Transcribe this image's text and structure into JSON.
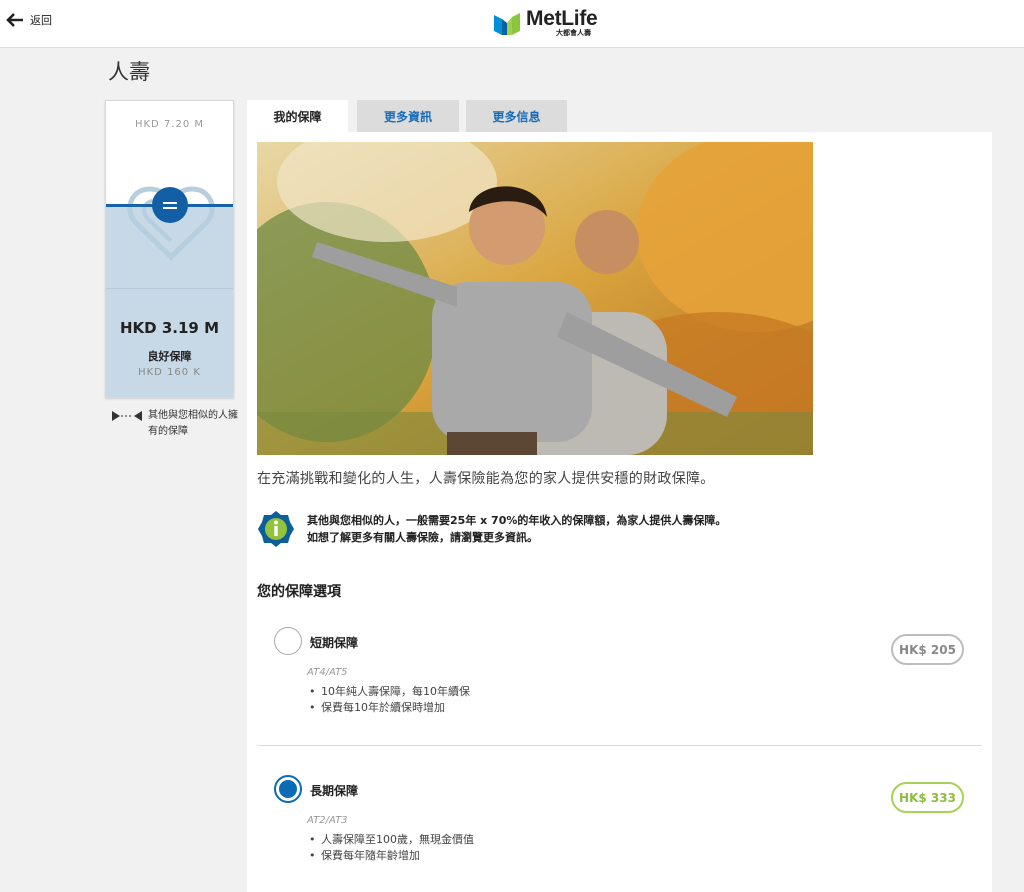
{
  "header": {
    "back_label": "返回",
    "logo_name": "MetLife",
    "logo_sub": "大都會人壽"
  },
  "page": {
    "title": "人壽"
  },
  "gauge": {
    "max_label": "HKD 7.20 M",
    "value_label": "HKD 3.19 M",
    "status_label": "良好保障",
    "min_label": "HKD 160 K",
    "level_fraction": 0.35,
    "legend_text": "其他與您相似的人擁有的保障"
  },
  "tabs": [
    {
      "label": "我的保障",
      "active": true
    },
    {
      "label": "更多資訊",
      "active": false
    },
    {
      "label": "更多信息",
      "active": false
    }
  ],
  "content": {
    "intro": "在充滿挑戰和變化的人生，人壽保險能為您的家人提供安穩的財政保障。",
    "info_line1": "其他與您相似的人，一般需要25年 x 70%的年收入的保障額，為家人提供人壽保障。",
    "info_line2": "如想了解更多有關人壽保險，請瀏覽更多資訊。",
    "options_title": "您的保障選項"
  },
  "options": [
    {
      "name": "短期保障",
      "code": "AT4/AT5",
      "bullets": [
        "10年純人壽保障，每10年續保",
        "保費每10年於續保時增加"
      ],
      "price": "HK$ 205",
      "selected": false
    },
    {
      "name": "長期保障",
      "code": "AT2/AT3",
      "bullets": [
        "人壽保障至100歲，無現金價值",
        "保費每年隨年齡增加"
      ],
      "price": "HK$ 333",
      "selected": true
    }
  ],
  "colors": {
    "brand_blue": "#135fa6",
    "link_blue": "#1a6db5",
    "price_green": "#8dbd3f",
    "gauge_fill": "#c7d8e6"
  }
}
